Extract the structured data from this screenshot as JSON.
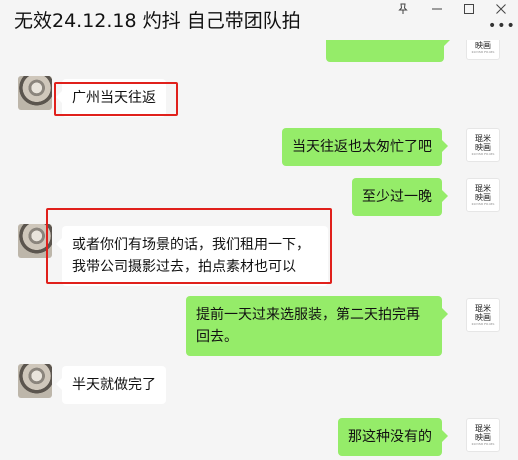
{
  "window": {
    "title": "无效24.12.18 灼抖 自己带团队拍",
    "pin_icon": "pin-icon",
    "minimize_icon": "minimize-icon",
    "maximize_icon": "maximize-icon",
    "close_icon": "close-icon",
    "more_icon": "more-icon"
  },
  "right_avatar": {
    "line1": "琨米",
    "line2": "映画",
    "sub": "KUNMI FILMS"
  },
  "messages": [
    {
      "side": "right",
      "text": ""
    },
    {
      "side": "left",
      "text": "广州当天往返"
    },
    {
      "side": "right",
      "text": "当天往返也太匆忙了吧"
    },
    {
      "side": "right",
      "text": "至少过一晚"
    },
    {
      "side": "left",
      "text": "或者你们有场景的话，我们租用一下，我带公司摄影过去，拍点素材也可以"
    },
    {
      "side": "right",
      "text": "提前一天过来选服装，第二天拍完再回去。"
    },
    {
      "side": "left",
      "text": "半天就做完了"
    },
    {
      "side": "right",
      "text": "那这种没有的"
    }
  ],
  "colors": {
    "self_bubble": "#95ec69",
    "other_bubble": "#ffffff",
    "highlight_box": "#e0201b",
    "background": "#f5f5f5"
  }
}
